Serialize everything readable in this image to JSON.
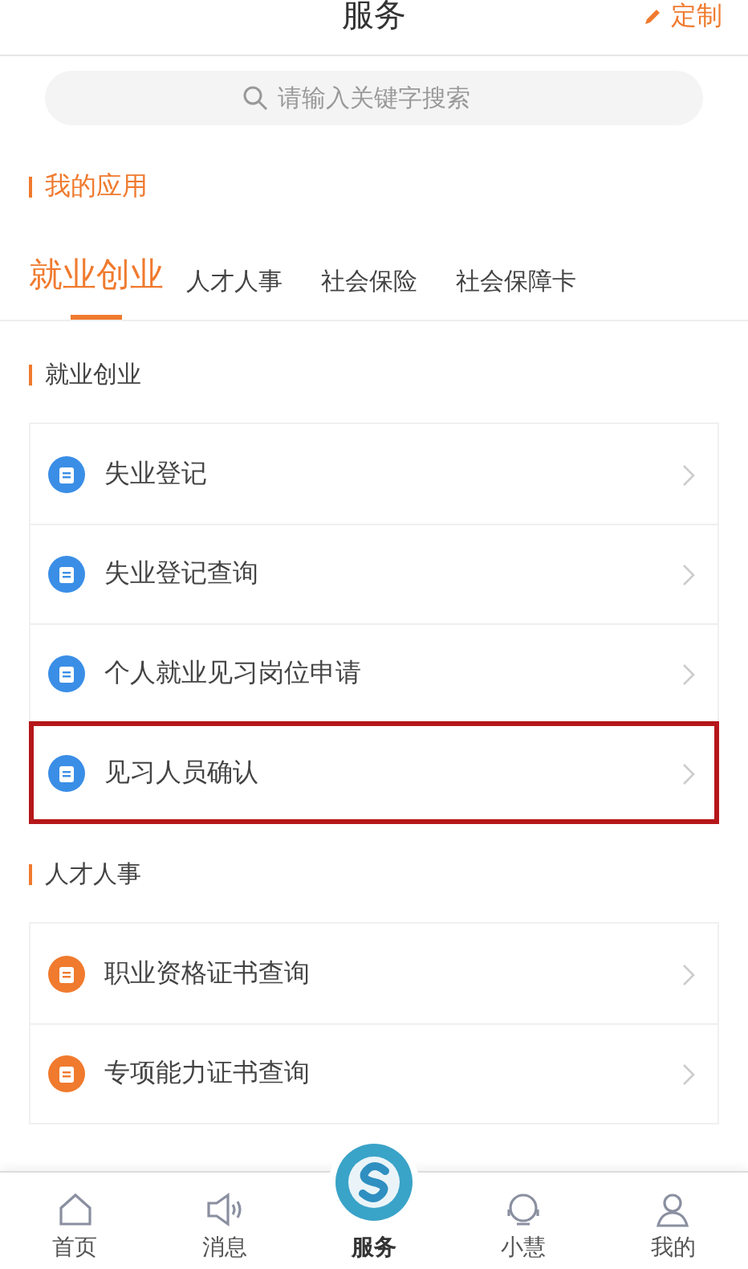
{
  "header": {
    "title": "服务",
    "action": "定制"
  },
  "search": {
    "placeholder": "请输入关键字搜索"
  },
  "my_apps": {
    "title": "我的应用"
  },
  "tabs": [
    {
      "label": "就业创业",
      "selected": true
    },
    {
      "label": "人才人事",
      "selected": false
    },
    {
      "label": "社会保险",
      "selected": false
    },
    {
      "label": "社会保障卡",
      "selected": false
    }
  ],
  "sections": [
    {
      "title": "就业创业",
      "color": "#3a8ee6",
      "items": [
        {
          "label": "失业登记",
          "highlighted": false
        },
        {
          "label": "失业登记查询",
          "highlighted": false
        },
        {
          "label": "个人就业见习岗位申请",
          "highlighted": false
        },
        {
          "label": "见习人员确认",
          "highlighted": true
        }
      ]
    },
    {
      "title": "人才人事",
      "color": "#f07a2e",
      "items": [
        {
          "label": "职业资格证书查询",
          "highlighted": false
        },
        {
          "label": "专项能力证书查询",
          "highlighted": false
        }
      ]
    }
  ],
  "tab_bar": [
    {
      "label": "首页",
      "kind": "home",
      "selected": false
    },
    {
      "label": "消息",
      "kind": "message",
      "selected": false
    },
    {
      "label": "服务",
      "kind": "service",
      "selected": true
    },
    {
      "label": "小慧",
      "kind": "assistant",
      "selected": false
    },
    {
      "label": "我的",
      "kind": "profile",
      "selected": false
    }
  ]
}
